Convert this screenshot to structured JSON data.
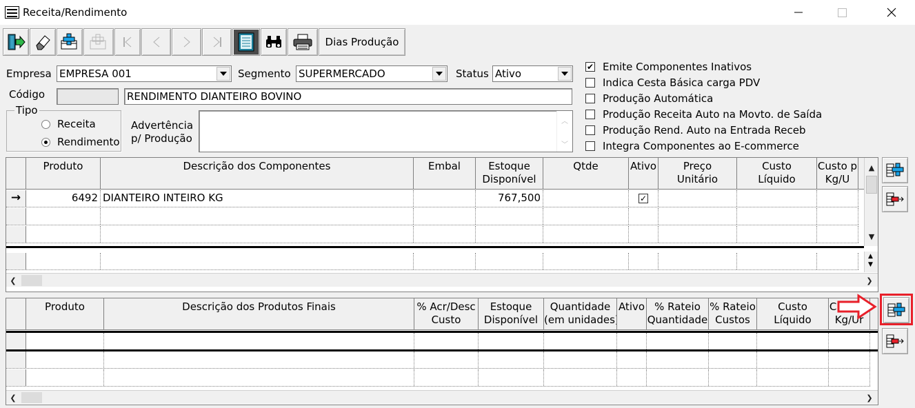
{
  "window": {
    "title": "Receita/Rendimento",
    "minimize": "—",
    "maximize": "☐",
    "close": "✕"
  },
  "toolbar": {
    "buttons": [
      {
        "name": "exit-icon"
      },
      {
        "name": "eraser-icon"
      },
      {
        "name": "new-icon"
      },
      {
        "name": "delete-icon"
      },
      {
        "name": "first-icon"
      },
      {
        "name": "prev-icon"
      },
      {
        "name": "next-icon"
      },
      {
        "name": "last-icon"
      },
      {
        "name": "notes-icon"
      },
      {
        "name": "binoculars-icon"
      },
      {
        "name": "printer-icon"
      }
    ],
    "dias_producao": "Dias Produção"
  },
  "form": {
    "empresa_label": "Empresa",
    "empresa_value": "EMPRESA 001",
    "segmento_label": "Segmento",
    "segmento_value": "SUPERMERCADO",
    "status_label": "Status",
    "status_value": "Ativo",
    "codigo_label": "Código",
    "codigo_value": "",
    "descricao_value": "RENDIMENTO DIANTEIRO BOVINO",
    "tipo_label": "Tipo",
    "tipo_options": [
      "Receita",
      "Rendimento"
    ],
    "tipo_selected": "Rendimento",
    "advertencia_label_1": "Advertência",
    "advertencia_label_2": "p/ Produção",
    "advertencia_value": ""
  },
  "options": [
    {
      "label": "Emite Componentes Inativos",
      "checked": true
    },
    {
      "label": "Indica Cesta Básica carga PDV",
      "checked": false
    },
    {
      "label": "Produção Automática",
      "checked": false
    },
    {
      "label": "Produção Receita Auto na Movto. de Saída",
      "checked": false
    },
    {
      "label": "Produção Rend. Auto na Entrada Receb",
      "checked": false
    },
    {
      "label": "Integra Componentes ao E-commerce",
      "checked": false
    }
  ],
  "components_grid": {
    "headers": [
      {
        "l1": "Produto",
        "l2": ""
      },
      {
        "l1": "Descrição dos Componentes",
        "l2": ""
      },
      {
        "l1": "Embal",
        "l2": ""
      },
      {
        "l1": "Estoque",
        "l2": "Disponível"
      },
      {
        "l1": "Qtde",
        "l2": ""
      },
      {
        "l1": "Ativo",
        "l2": ""
      },
      {
        "l1": "Preço",
        "l2": "Unitário"
      },
      {
        "l1": "Custo",
        "l2": "Líquido"
      },
      {
        "l1": "Custo p",
        "l2": "Kg/U"
      }
    ],
    "rows": [
      {
        "indicator": "→",
        "produto": "6492",
        "descricao": "DIANTEIRO INTEIRO KG",
        "embal": "",
        "estoque": "767,500",
        "qtde": "",
        "ativo": true,
        "preco": "",
        "custo": "",
        "custo_kg": ""
      }
    ]
  },
  "final_grid": {
    "headers": [
      {
        "l1": "Produto",
        "l2": ""
      },
      {
        "l1": "Descrição dos Produtos Finais",
        "l2": ""
      },
      {
        "l1": "% Acr/Desc",
        "l2": "Custo"
      },
      {
        "l1": "Estoque",
        "l2": "Disponível"
      },
      {
        "l1": "Quantidade",
        "l2": "(em unidades)"
      },
      {
        "l1": "Ativo",
        "l2": ""
      },
      {
        "l1": "% Rateio",
        "l2": "Quantidade"
      },
      {
        "l1": "% Rateio",
        "l2": "Custos"
      },
      {
        "l1": "Custo",
        "l2": "Líquido"
      },
      {
        "l1": "Custo p",
        "l2": "Kg/Ur"
      }
    ]
  },
  "side_buttons": [
    {
      "name": "add-component-icon"
    },
    {
      "name": "remove-component-icon"
    },
    {
      "name": "add-final-product-icon"
    },
    {
      "name": "remove-final-product-icon"
    }
  ],
  "colors": {
    "highlight": "#e8202a",
    "add_accent": "#1aa3e8",
    "remove_accent": "#e8202a"
  }
}
